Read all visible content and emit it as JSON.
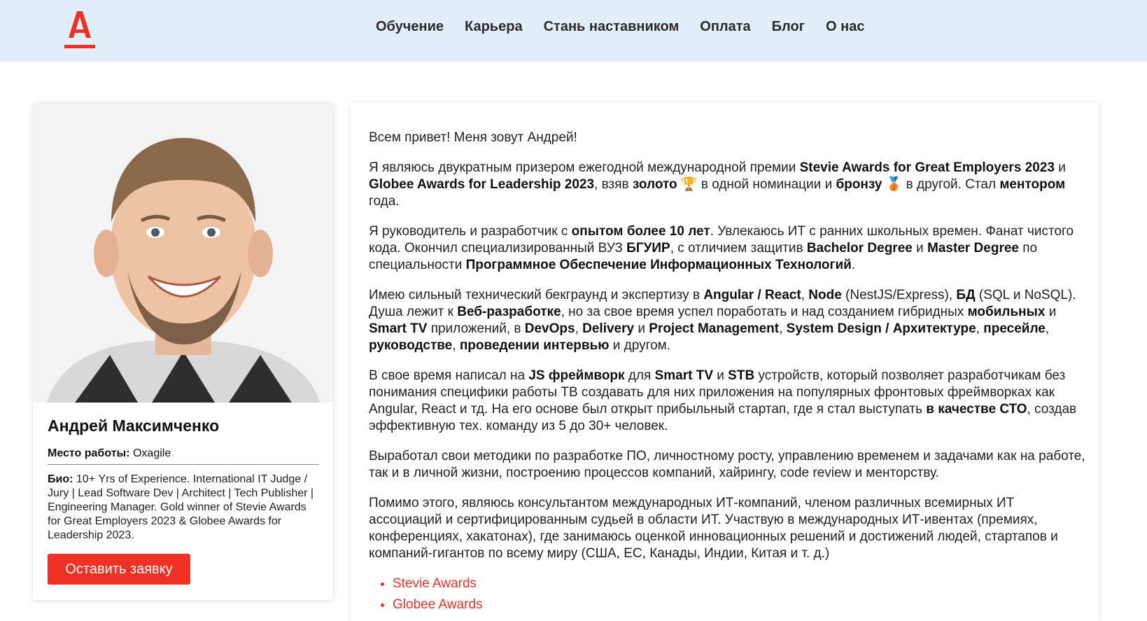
{
  "header": {
    "logo_icon": "alfa-logo-icon",
    "accent_color": "#ef3124",
    "nav": [
      "Обучение",
      "Карьера",
      "Стань наставником",
      "Оплата",
      "Блог",
      "О нас"
    ]
  },
  "profile": {
    "name": "Андрей Максимченко",
    "workplace_label": "Место работы:",
    "workplace_value": "Oxagile",
    "bio_label": "Био:",
    "bio_text": "10+ Yrs of Experience. International IT Judge / Jury | Lead Software Dev | Architect | Tech Publisher | Engineering Manager. Gold winner of Stevie Awards for Great Employers 2023 & Globee Awards for Leadership 2023.",
    "cta_label": "Оставить заявку"
  },
  "about": {
    "p1": "Всем привет! Меня зовут Андрей!",
    "p2": [
      "Я являюсь двукратным призером ежегодной международной премии ",
      "Stevie Awards for Great Employers 2023",
      " и ",
      "Globee Awards for Leadership 2023",
      ", взяв ",
      "золото",
      " 🏆 в одной номинации и ",
      "бронзу",
      " 🥉 в другой. Стал ",
      "ментором",
      " года."
    ],
    "p3": [
      "Я руководитель и разработчик с ",
      "опытом более 10 лет",
      ". Увлекаюсь ИТ с ранних школьных времен. Фанат чистого кода. Окончил специализированный ВУЗ ",
      "БГУИР",
      ", с отличием защитив ",
      "Bachelor Degree",
      " и ",
      "Master Degree",
      " по специальности ",
      "Программное Обеспечение Информационных Технологий",
      "."
    ],
    "p4": [
      "Имею сильный технический бекграунд и экспертизу в ",
      "Angular / React",
      ", ",
      "Node",
      " (NestJS/Express), ",
      "БД",
      " (SQL и NoSQL). Душа лежит к ",
      "Веб-разработке",
      ", но за свое время успел поработать и над созданием гибридных ",
      "мобильных",
      " и ",
      "Smart TV",
      " приложений, в ",
      "DevOps",
      ", ",
      "Delivery",
      " и ",
      "Project Management",
      ", ",
      "System Design / Архитектуре",
      ", ",
      "пресейле",
      ", ",
      "руководстве",
      ", ",
      "проведении интервью",
      " и другом."
    ],
    "p5": [
      "В свое время написал на ",
      "JS фреймворк",
      " для ",
      "Smart TV",
      " и ",
      "STB",
      " устройств, который позволяет разработчикам без понимания специфики работы ТВ создавать для них приложения на популярных фронтовых фреймворках как Angular, React и тд. На его основе был открыт прибыльный стартап, где я стал выступать ",
      "в качестве СТО",
      ", создав эффективную тех. команду из 5 до 30+ человек."
    ],
    "p6": "Выработал свои методики по разработке ПО, личностному росту, управлению временем и задачами как на работе, так и в личной жизни, построению процессов компаний, хайрингу, code review и менторству.",
    "p7": "Помимо этого, являюсь консультантом международных ИТ-компаний, членом различных всемирных ИТ ассоциаций и сертифицированным судьей в области ИТ. Участвую в международных ИТ-ивентах (премиях, конференциях, хакатонах), где занимаюсь оценкой инновационных решений и достижений людей, стартапов и компаний-гигантов по всему миру (США, ЕС, Канады, Индии, Китая и т. д.)",
    "links": [
      "Stevie Awards",
      "Globee Awards"
    ]
  }
}
